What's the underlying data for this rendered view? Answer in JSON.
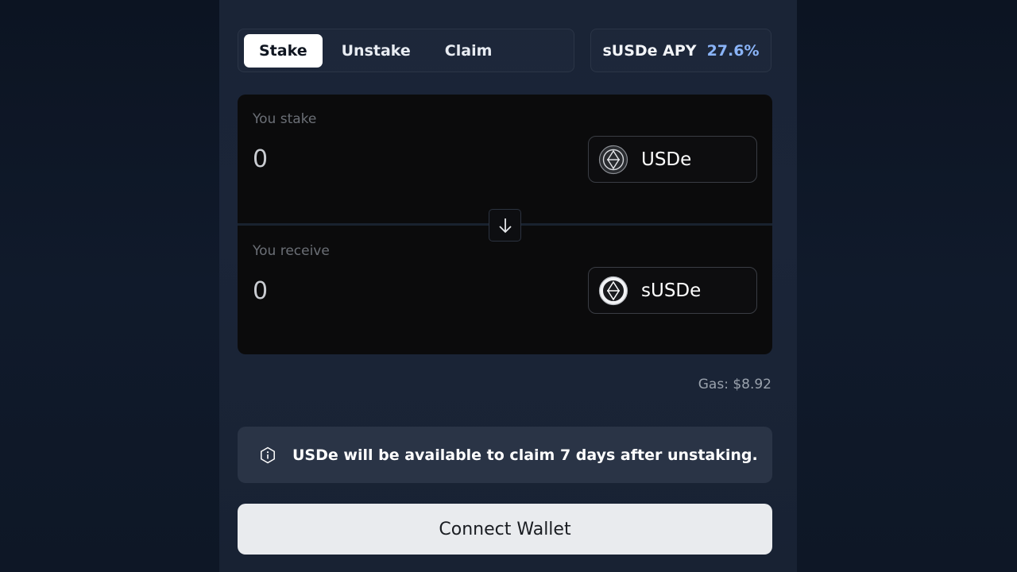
{
  "tabs": [
    {
      "label": "Stake",
      "active": true
    },
    {
      "label": "Unstake",
      "active": false
    },
    {
      "label": "Claim",
      "active": false
    }
  ],
  "apy": {
    "label": "sUSDe APY",
    "value": "27.6%"
  },
  "stake": {
    "label": "You stake",
    "amount": "0",
    "token": "USDe",
    "token_icon": "usde-token-icon"
  },
  "receive": {
    "label": "You receive",
    "amount": "0",
    "token": "sUSDe",
    "token_icon": "susde-token-icon"
  },
  "swap_direction_icon": "arrow-down-icon",
  "gas": "Gas: $8.92",
  "notice": {
    "icon": "info-icon",
    "text": "USDe will be available to claim 7 days after unstaking."
  },
  "connect_button": "Connect Wallet",
  "colors": {
    "accent": "#8ab4f8",
    "card": "#0b0b0c",
    "notice_bg": "#2a3446",
    "button_bg": "#e9ebee"
  }
}
